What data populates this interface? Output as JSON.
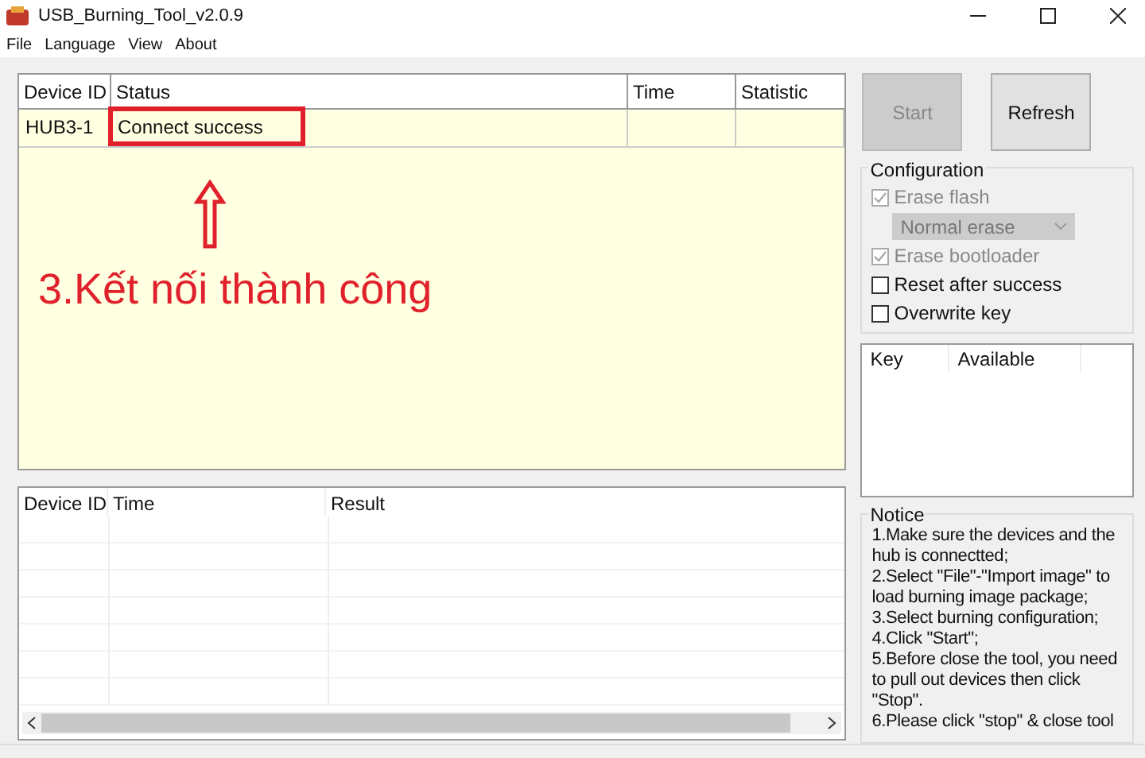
{
  "window": {
    "title": "USB_Burning_Tool_v2.0.9"
  },
  "menu": [
    "File",
    "Language",
    "View",
    "About"
  ],
  "device_table": {
    "columns": [
      "Device ID",
      "Status",
      "Time",
      "Statistic"
    ],
    "rows": [
      {
        "device_id": "HUB3-1",
        "status": "Connect success"
      }
    ]
  },
  "annotation": {
    "text": "3.Kết nối thành công"
  },
  "buttons": [
    {
      "label": "Start",
      "disabled": true
    },
    {
      "label": "Refresh",
      "disabled": false
    }
  ],
  "configuration": {
    "title": "Configuration",
    "options": [
      {
        "kind": "checkbox",
        "label": "Erase flash",
        "checked": true,
        "disabled": true
      },
      {
        "kind": "dropdown",
        "value": "Normal erase",
        "disabled": true
      },
      {
        "kind": "checkbox",
        "label": "Erase bootloader",
        "checked": true,
        "disabled": true
      },
      {
        "kind": "checkbox",
        "label": "Reset after success",
        "checked": false,
        "disabled": false
      },
      {
        "kind": "checkbox",
        "label": "Overwrite key",
        "checked": false,
        "disabled": false
      }
    ]
  },
  "key_table": {
    "columns": [
      "Key",
      "Available"
    ]
  },
  "result_table": {
    "columns": [
      "Device ID",
      "Time",
      "Result"
    ]
  },
  "notice": {
    "title": "Notice",
    "lines": [
      "1.Make sure the devices and the hub is connectted;",
      "2.Select \"File\"-\"Import image\" to load burning image package;",
      "3.Select burning configuration;",
      "4.Click \"Start\";",
      "5.Before close the tool, you need to pull out devices then click \"Stop\".",
      "6.Please click \"stop\" & close tool"
    ]
  }
}
